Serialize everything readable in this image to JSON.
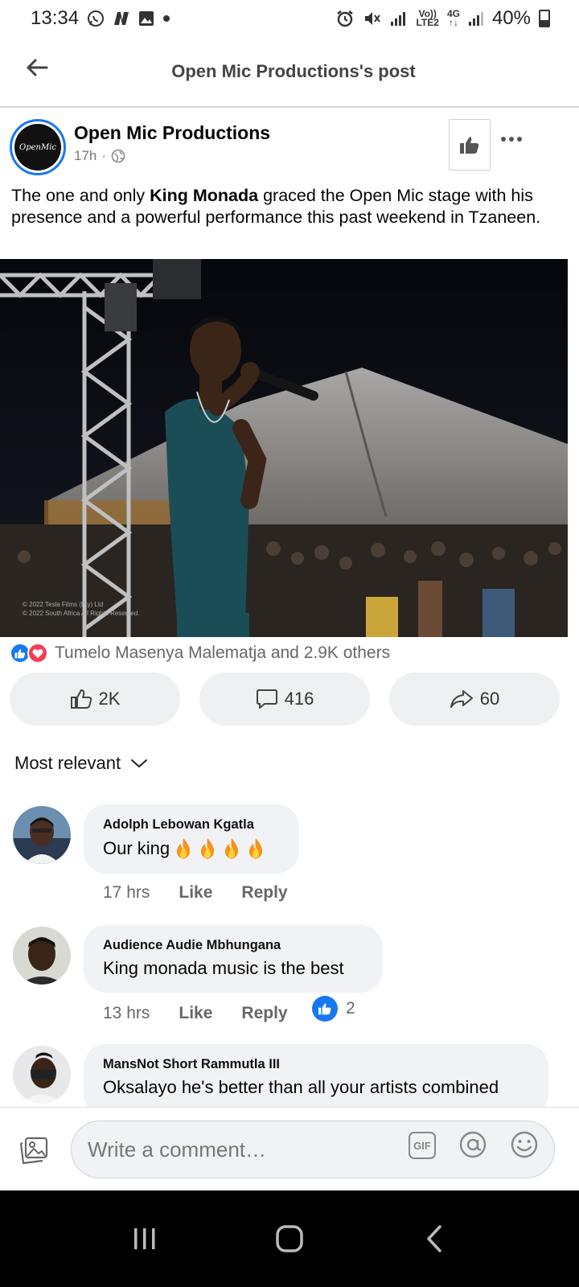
{
  "status_bar": {
    "time": "13:34",
    "network_volte": "Vo))",
    "network_lte": "LTE2",
    "network_4g": "4G",
    "battery": "40%"
  },
  "header": {
    "title": "Open Mic Productions's post"
  },
  "post": {
    "page_name": "Open Mic Productions",
    "avatar_text": "OpenMic",
    "time": "17h",
    "separator": "·",
    "text_before": "The one and only ",
    "text_bold": "King Monada",
    "text_after": " graced the Open Mic stage with his presence and a powerful performance this past weekend in Tzaneen.",
    "photo_watermark_1": "© 2022 Tesla Films (Pty) Ltd",
    "photo_watermark_2": "© 2022 South Africa All Rights Reserved."
  },
  "reactions": {
    "summary": "Tumelo Masenya Malematja and 2.9K others"
  },
  "actions": {
    "like_count": "2K",
    "comment_count": "416",
    "share_count": "60"
  },
  "sort": {
    "label": "Most relevant"
  },
  "comments": [
    {
      "author": "Adolph Lebowan Kgatla",
      "text": "Our king",
      "time": "17 hrs",
      "like": "Like",
      "reply": "Reply"
    },
    {
      "author": "Audience Audie Mbhungana",
      "text": "King monada music is the best",
      "time": "13 hrs",
      "like": "Like",
      "reply": "Reply",
      "reaction_count": "2"
    },
    {
      "author": "MansNot Short Rammutla III",
      "text": "Oksalayo he's better than all your artists combined"
    }
  ],
  "composer": {
    "placeholder": "Write a comment…",
    "gif_label": "GIF"
  },
  "colors": {
    "accent": "#1877f2",
    "love": "#f33e58",
    "bubble": "#f0f2f5",
    "nav": "#000000"
  },
  "icons": {
    "back": "arrow-left-icon",
    "globe": "globe-icon",
    "like_page": "thumbs-up-icon",
    "more": "more-dots-icon",
    "comment": "speech-bubble-icon",
    "share": "share-arrow-icon",
    "sort": "chevron-down-icon"
  }
}
